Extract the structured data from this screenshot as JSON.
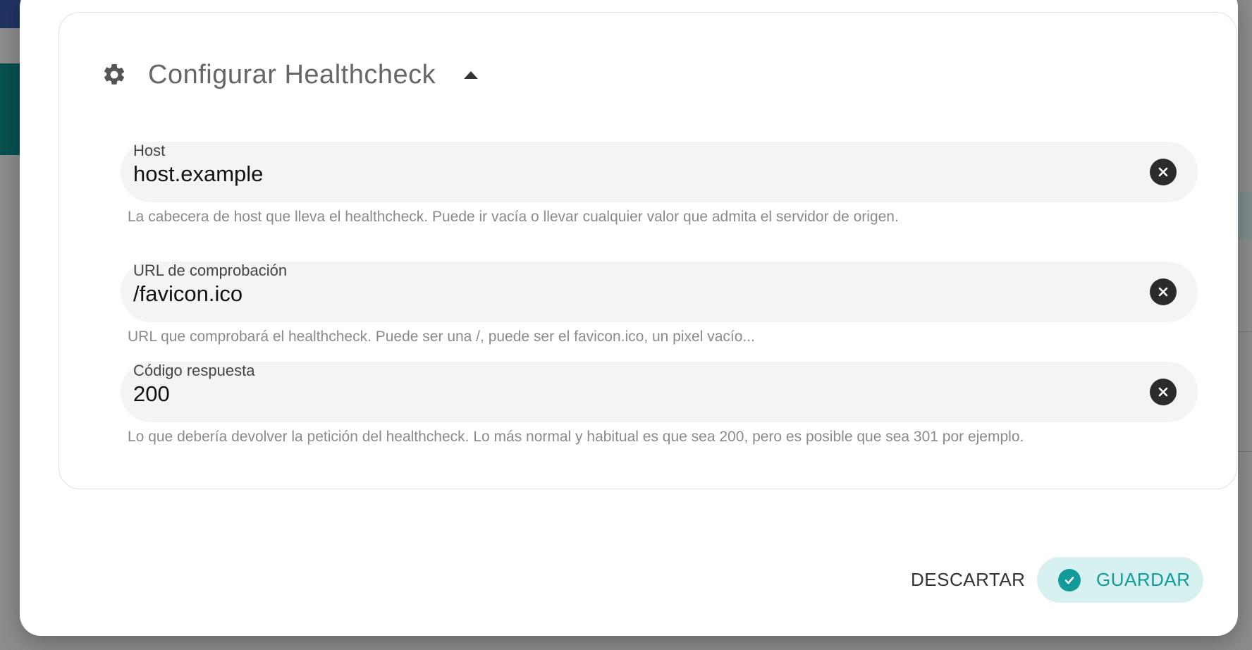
{
  "section": {
    "title": "Configurar Healthcheck",
    "icon": "gear-icon",
    "toggle_icon": "caret-up-icon"
  },
  "fields": [
    {
      "label": "Host",
      "value": "host.example",
      "helper": "La cabecera de host que lleva el healthcheck. Puede ir vacía o llevar cualquier valor que admita el servidor de origen."
    },
    {
      "label": "URL de comprobación",
      "value": "/favicon.ico",
      "helper": "URL que comprobará el healthcheck. Puede ser una /, puede ser el favicon.ico, un pixel vacío..."
    },
    {
      "label": "Código respuesta",
      "value": "200",
      "helper": "Lo que debería devolver la petición del healthcheck. Lo más normal y habitual es que sea 200, pero es posible que sea 301 por ejemplo."
    }
  ],
  "actions": {
    "discard_label": "DESCARTAR",
    "save_label": "GUARDAR"
  },
  "colors": {
    "accent": "#139a9a",
    "accent_soft": "#d7f1f1"
  }
}
